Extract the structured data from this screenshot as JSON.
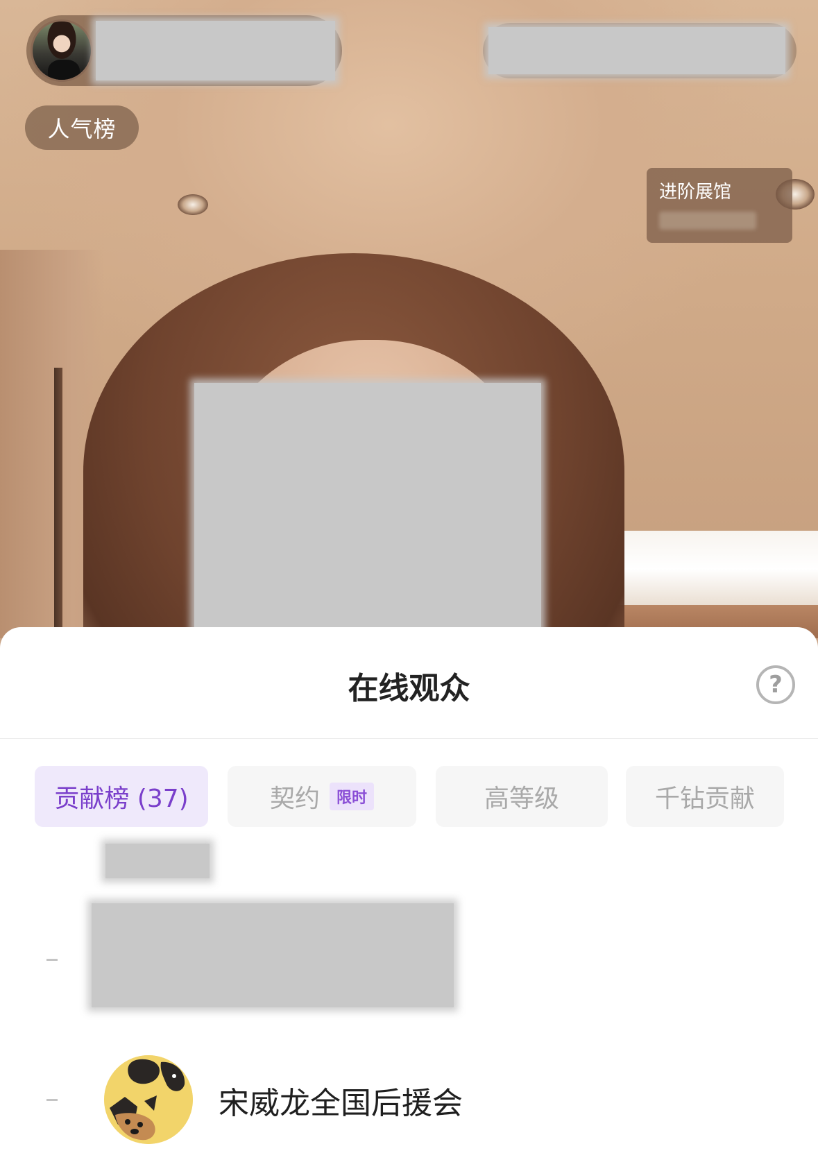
{
  "stream": {
    "badge": "人气榜",
    "exhibit_title": "进阶展馆"
  },
  "sheet": {
    "title": "在线观众",
    "help_icon_glyph": "?",
    "tabs": [
      {
        "label": "贡献榜 (37)",
        "active": true
      },
      {
        "label": "契约",
        "tag": "限时",
        "active": false
      },
      {
        "label": "高等级",
        "active": false
      },
      {
        "label": "千钻贡献",
        "active": false
      }
    ],
    "viewers": [
      {
        "rank_marker": "-",
        "name": "宋威龙全国后援会",
        "avatar_icon": "cartoon-dog-avatar"
      }
    ]
  },
  "colors": {
    "accent": "#7a3fcb",
    "active_tab_bg": "#efe9fb",
    "tab_bg": "#f6f6f6",
    "title_text": "#222222"
  }
}
